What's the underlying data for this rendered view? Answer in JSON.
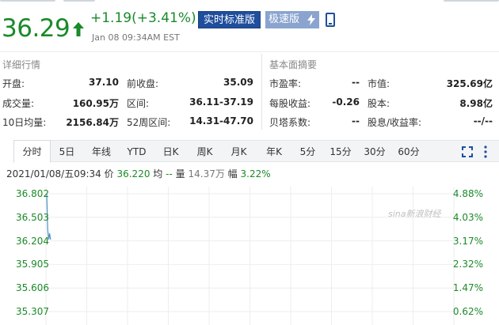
{
  "quote": {
    "price": "36.29",
    "change": "+1.19(+3.41%)",
    "time": "Jan 08 09:34AM EST",
    "realtime_label": "实时标准版",
    "fast_label": "极速版"
  },
  "details": {
    "title": "详细行情",
    "rows": [
      [
        {
          "label": "开盘:",
          "value": "37.10"
        },
        {
          "label": "前收盘:",
          "value": "35.09"
        }
      ],
      [
        {
          "label": "成交量:",
          "value": "160.95万"
        },
        {
          "label": "区间:",
          "value": "36.11-37.19"
        }
      ],
      [
        {
          "label": "10日均量:",
          "value": "2156.84万"
        },
        {
          "label": "52周区间:",
          "value": "14.31-47.70"
        }
      ]
    ]
  },
  "fundamentals": {
    "title": "基本面摘要",
    "rows": [
      [
        {
          "label": "市盈率:",
          "value": "--"
        },
        {
          "label": "市值:",
          "value": "325.69亿"
        }
      ],
      [
        {
          "label": "每股收益:",
          "value": "-0.26"
        },
        {
          "label": "股本:",
          "value": "8.98亿"
        }
      ],
      [
        {
          "label": "贝塔系数:",
          "value": "--"
        },
        {
          "label": "股息/收益率:",
          "value": "--/--"
        }
      ]
    ]
  },
  "tabs": [
    "分时",
    "5日",
    "年线",
    "YTD",
    "日K",
    "周K",
    "月K",
    "年K",
    "5分",
    "15分",
    "30分",
    "60分"
  ],
  "active_tab": "分时",
  "status": {
    "datetime": "2021/01/08/五09:34",
    "price_label": "价",
    "price_value": "36.220",
    "avg_label": "均",
    "avg_value": "--",
    "volume_label": "量",
    "volume_value": "14.37万",
    "amplitude_label": "幅",
    "amplitude_value": "3.22%"
  },
  "watermark": "sina新浪财经",
  "colors": {
    "up": "#1a8a2a",
    "accent": "#1f4e9c",
    "line": "#4a90c8"
  },
  "chart_data": {
    "type": "line",
    "y_left_ticks": [
      "36.802",
      "36.503",
      "36.204",
      "35.905",
      "35.606",
      "35.307"
    ],
    "y_right_ticks": [
      "4.88%",
      "4.03%",
      "3.17%",
      "2.32%",
      "1.47%",
      "0.62%"
    ],
    "ylim": [
      35.307,
      36.802
    ],
    "series": [
      {
        "x": [
          0,
          1,
          2,
          3,
          4
        ],
        "y": [
          36.8,
          36.35,
          36.22,
          36.3,
          36.22
        ]
      }
    ],
    "grid": true
  }
}
